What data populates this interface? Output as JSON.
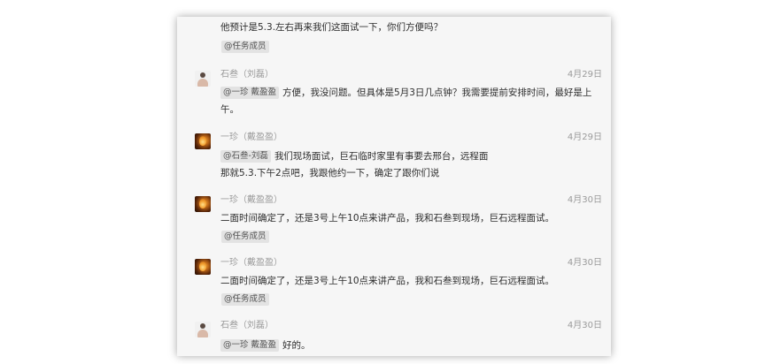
{
  "messages": [
    {
      "text": "他预计是5.3.左右再来我们这面试一下，你们方便吗？",
      "chip": "@任务成员"
    },
    {
      "sender": "石叁（刘磊）",
      "date": "4月29日",
      "mention": "@一珍 戴盈盈",
      "text": "方便，我没问题。但具体是5月3日几点钟？我需要提前安排时间，最好是上午。"
    },
    {
      "sender": "一珍（戴盈盈）",
      "date": "4月29日",
      "mention": "@石叁-刘磊",
      "text": "我们现场面试，巨石临时家里有事要去邢台，远程面",
      "text2": "那就5.3.下午2点吧，我跟他约一下，确定了跟你们说"
    },
    {
      "sender": "一珍（戴盈盈）",
      "date": "4月30日",
      "text": "二面时间确定了，还是3号上午10点来讲产品，我和石叁到现场，巨石远程面试。",
      "chip": "@任务成员"
    },
    {
      "sender": "一珍（戴盈盈）",
      "date": "4月30日",
      "text": "二面时间确定了，还是3号上午10点来讲产品，我和石叁到现场，巨石远程面试。",
      "chip": "@任务成员"
    },
    {
      "sender": "石叁（刘磊）",
      "date": "4月30日",
      "mention": "@一珍 戴盈盈",
      "text": "好的。"
    }
  ]
}
